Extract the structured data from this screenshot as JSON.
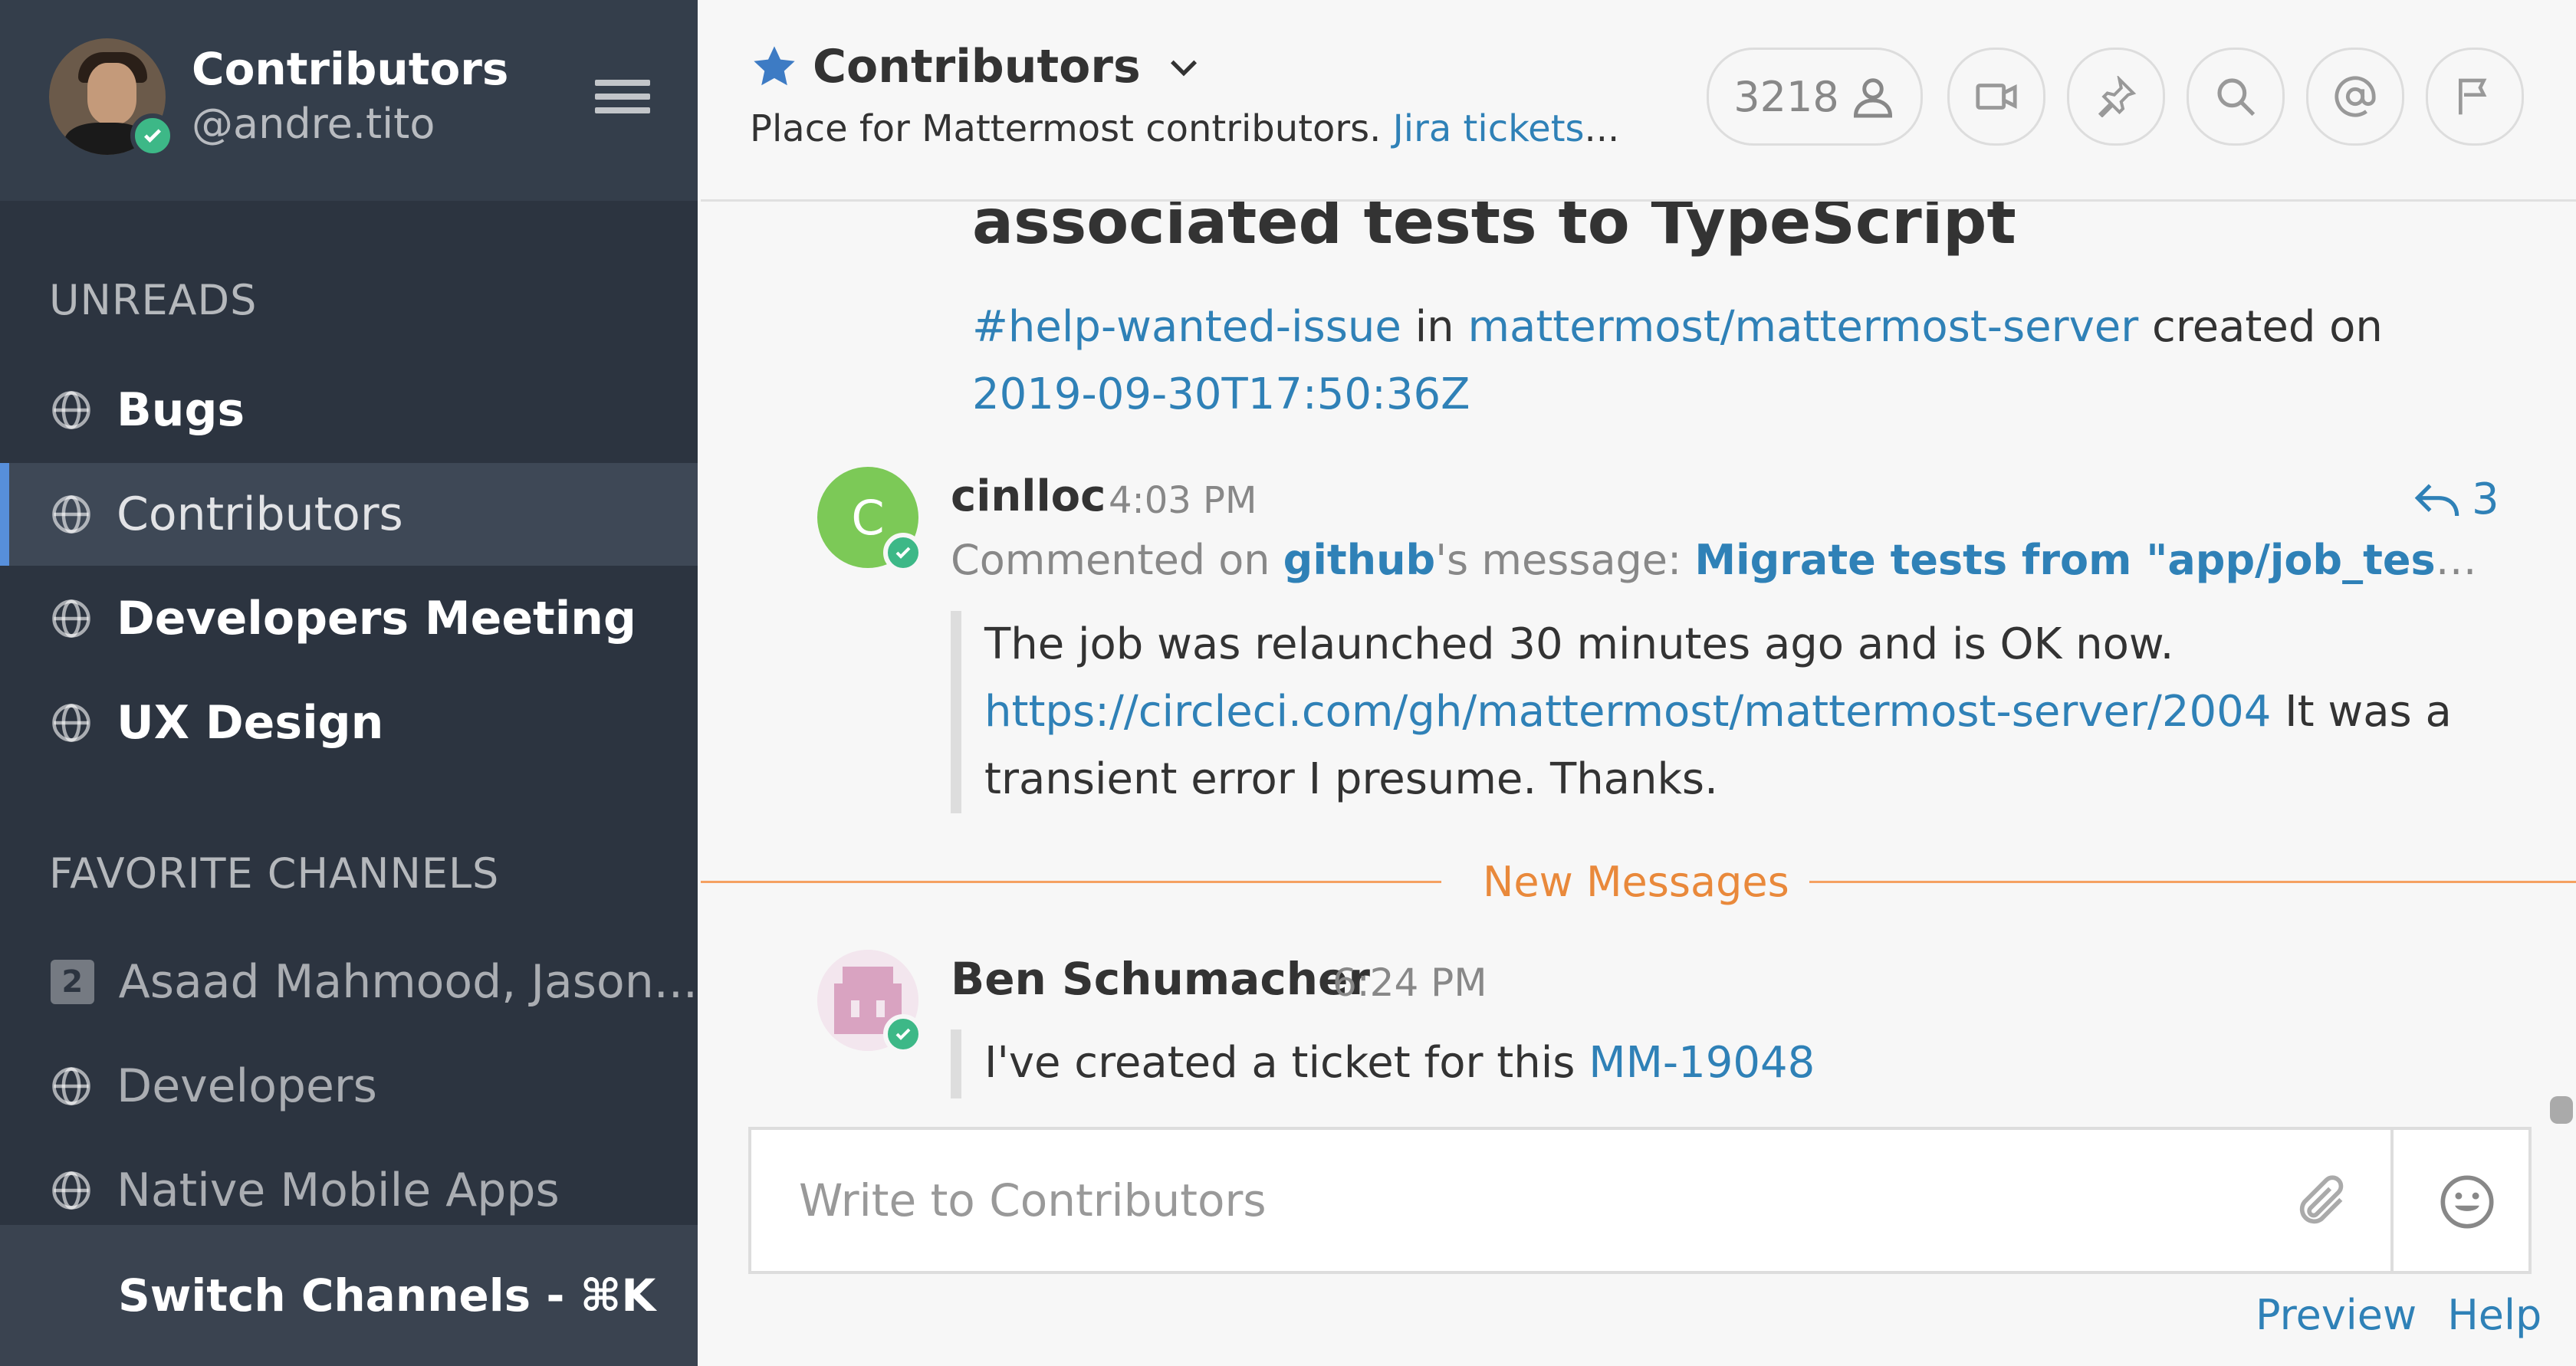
{
  "sidebar": {
    "team_name": "Contributors",
    "username": "@andre.tito",
    "sections": {
      "unreads_title": "UNREADS",
      "favorites_title": "FAVORITE CHANNELS"
    },
    "unreads": [
      {
        "label": "Bugs"
      },
      {
        "label": "Contributors"
      },
      {
        "label": "Developers Meeting"
      },
      {
        "label": "UX Design"
      }
    ],
    "favorites": [
      {
        "label": "Asaad Mahmood, Jason...",
        "badge": "2"
      },
      {
        "label": "Developers"
      },
      {
        "label": "Native Mobile Apps"
      }
    ],
    "switch_label": "Switch Channels - ⌘K"
  },
  "header": {
    "channel_name": "Contributors",
    "purpose_text": "Place for Mattermost contributors. ",
    "purpose_link": "Jira tickets",
    "purpose_ellipsis": "...",
    "member_count": "3218"
  },
  "posts": {
    "card_title": "associated tests to TypeScript",
    "card_hashtag": "#help-wanted-issue",
    "card_in": " in ",
    "card_repo": "mattermost/mattermost-server",
    "card_created": " created on ",
    "card_date": "2019-09-30T17:50:36Z",
    "post1": {
      "avatar_letter": "C",
      "name": "cinlloc",
      "time": "4:03 PM",
      "reply_count": "3",
      "commented_on": "Commented on ",
      "github": "github",
      "message_prefix": "'s message: ",
      "message_title": "Migrate tests from \"app/job_test.go\" to us...",
      "body_line1": "The job was relaunched 30 minutes ago and is OK now.",
      "body_link": "https://circleci.com/gh/mattermost/mattermost-server/2004",
      "body_rest": " It was a transient error I presume. Thanks."
    },
    "new_messages": "New Messages",
    "post2": {
      "name": "Ben Schumacher",
      "time": "6:24 PM",
      "body_text": "I've created a ticket for this ",
      "body_link": "MM-19048"
    }
  },
  "composer": {
    "placeholder": "Write to Contributors"
  },
  "footer": {
    "preview": "Preview",
    "help": "Help"
  },
  "colors": {
    "sidebar_bg": "#2c3440",
    "link": "#2f81b7",
    "online": "#3db887",
    "new_messages": "#e9893b"
  }
}
